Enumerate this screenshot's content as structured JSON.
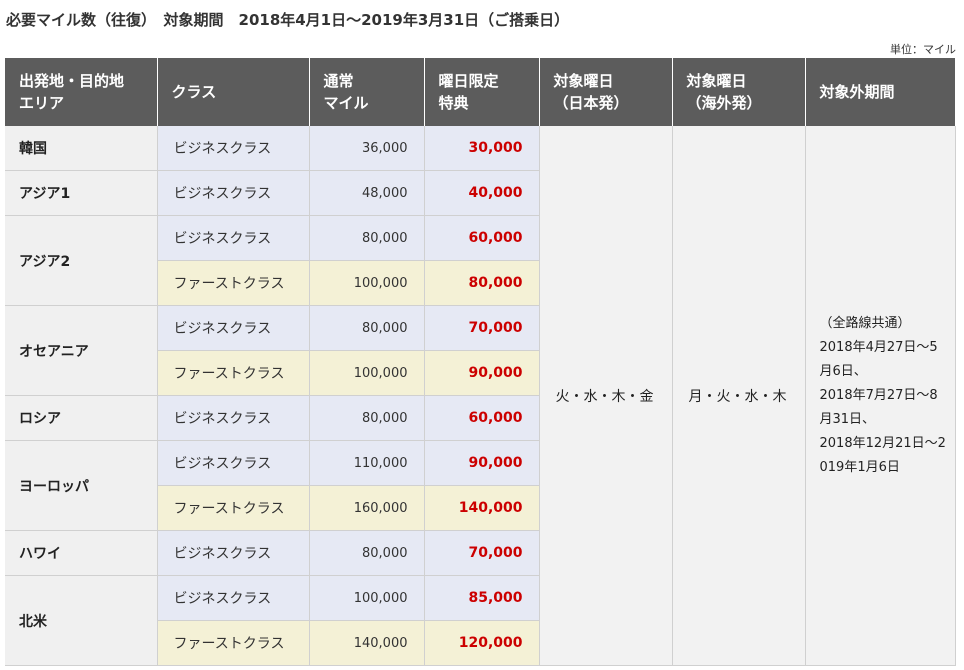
{
  "title": "必要マイル数（往復）　対象期間　2018年4月1日～2019年3月31日（ご搭乗日）",
  "unit": "単位：マイル",
  "headers": {
    "area": [
      "出発地・目的地",
      "エリア"
    ],
    "class": [
      "クラス"
    ],
    "normal": [
      "通常",
      "マイル"
    ],
    "special": [
      "曜日限定",
      "特典"
    ],
    "days_jp": [
      "対象曜日",
      "（日本発）"
    ],
    "days_intl": [
      "対象曜日",
      "（海外発）"
    ],
    "excluded": [
      "対象外期間"
    ]
  },
  "regions": [
    {
      "area": "韓国",
      "rows": [
        {
          "class": "ビジネスクラス",
          "type": "biz",
          "normal": "36,000",
          "special": "30,000"
        }
      ]
    },
    {
      "area": "アジア1",
      "rows": [
        {
          "class": "ビジネスクラス",
          "type": "biz",
          "normal": "48,000",
          "special": "40,000"
        }
      ]
    },
    {
      "area": "アジア2",
      "rows": [
        {
          "class": "ビジネスクラス",
          "type": "biz",
          "normal": "80,000",
          "special": "60,000"
        },
        {
          "class": "ファーストクラス",
          "type": "first",
          "normal": "100,000",
          "special": "80,000"
        }
      ]
    },
    {
      "area": "オセアニア",
      "rows": [
        {
          "class": "ビジネスクラス",
          "type": "biz",
          "normal": "80,000",
          "special": "70,000"
        },
        {
          "class": "ファーストクラス",
          "type": "first",
          "normal": "100,000",
          "special": "90,000"
        }
      ]
    },
    {
      "area": "ロシア",
      "rows": [
        {
          "class": "ビジネスクラス",
          "type": "biz",
          "normal": "80,000",
          "special": "60,000"
        }
      ]
    },
    {
      "area": "ヨーロッパ",
      "rows": [
        {
          "class": "ビジネスクラス",
          "type": "biz",
          "normal": "110,000",
          "special": "90,000"
        },
        {
          "class": "ファーストクラス",
          "type": "first",
          "normal": "160,000",
          "special": "140,000"
        }
      ]
    },
    {
      "area": "ハワイ",
      "rows": [
        {
          "class": "ビジネスクラス",
          "type": "biz",
          "normal": "80,000",
          "special": "70,000"
        }
      ]
    },
    {
      "area": "北米",
      "rows": [
        {
          "class": "ビジネスクラス",
          "type": "biz",
          "normal": "100,000",
          "special": "85,000"
        },
        {
          "class": "ファーストクラス",
          "type": "first",
          "normal": "140,000",
          "special": "120,000"
        }
      ]
    }
  ],
  "days_jp": "火・水・木・金",
  "days_intl": "月・火・水・木",
  "excluded_lines": [
    "（全路線共通）",
    "2018年4月27日～5月6日、",
    "2018年7月27日～8月31日、",
    "2018年12月21日～2019年1月6日"
  ],
  "colors": {
    "header_bg": "#5c5c5c",
    "business_bg": "#e6e9f4",
    "first_bg": "#f4f1d6",
    "area_bg": "#f0f0f0",
    "special_text": "#cc0000"
  }
}
